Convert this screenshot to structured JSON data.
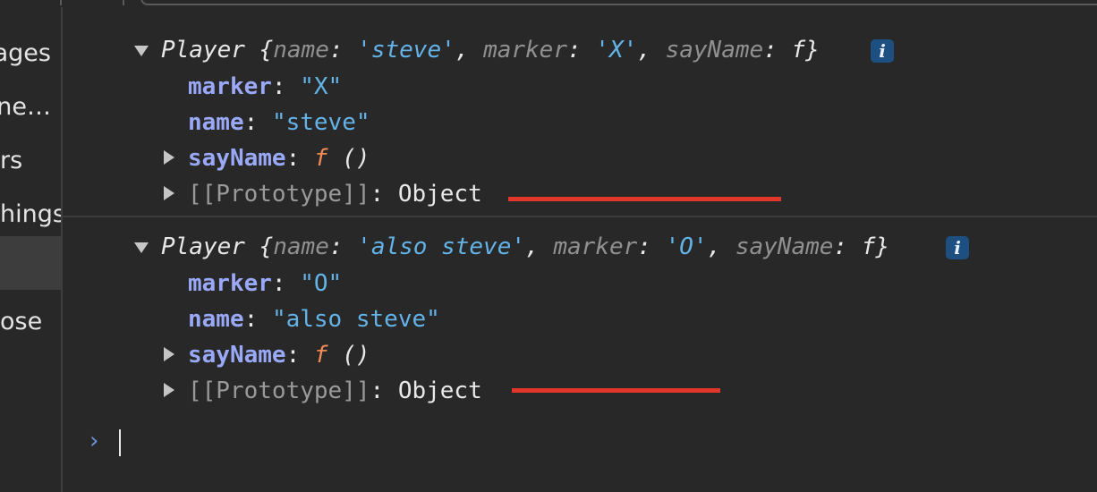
{
  "sidebar": {
    "items": [
      {
        "label": "ages"
      },
      {
        "label": "ne…"
      },
      {
        "label": "rs"
      },
      {
        "label": "hings"
      },
      {
        "label": ""
      },
      {
        "label": "ose"
      }
    ]
  },
  "console": {
    "entries": [
      {
        "class_name": "Player",
        "preview": {
          "k1": "name",
          "v1": "'steve'",
          "k2": "marker",
          "v2": "'X'",
          "k3": "sayName",
          "v3": "f"
        },
        "info_badge": "i",
        "props": [
          {
            "key": "marker",
            "value": "\"X\""
          },
          {
            "key": "name",
            "value": "\"steve\""
          },
          {
            "key": "sayName",
            "fn": "f",
            "value": "()"
          },
          {
            "key": "[[Prototype]]",
            "value": "Object"
          }
        ]
      },
      {
        "class_name": "Player",
        "preview": {
          "k1": "name",
          "v1": "'also steve'",
          "k2": "marker",
          "v2": "'O'",
          "k3": "sayName",
          "v3": "f"
        },
        "info_badge": "i",
        "props": [
          {
            "key": "marker",
            "value": "\"O\""
          },
          {
            "key": "name",
            "value": "\"also steve\""
          },
          {
            "key": "sayName",
            "fn": "f",
            "value": "()"
          },
          {
            "key": "[[Prototype]]",
            "value": "Object"
          }
        ]
      }
    ],
    "prompt_symbol": "›"
  },
  "colors": {
    "background": "#282828",
    "key": "#9aa8f8",
    "string": "#63b3e8",
    "function": "#f28b54",
    "annotation": "#e0372a"
  }
}
